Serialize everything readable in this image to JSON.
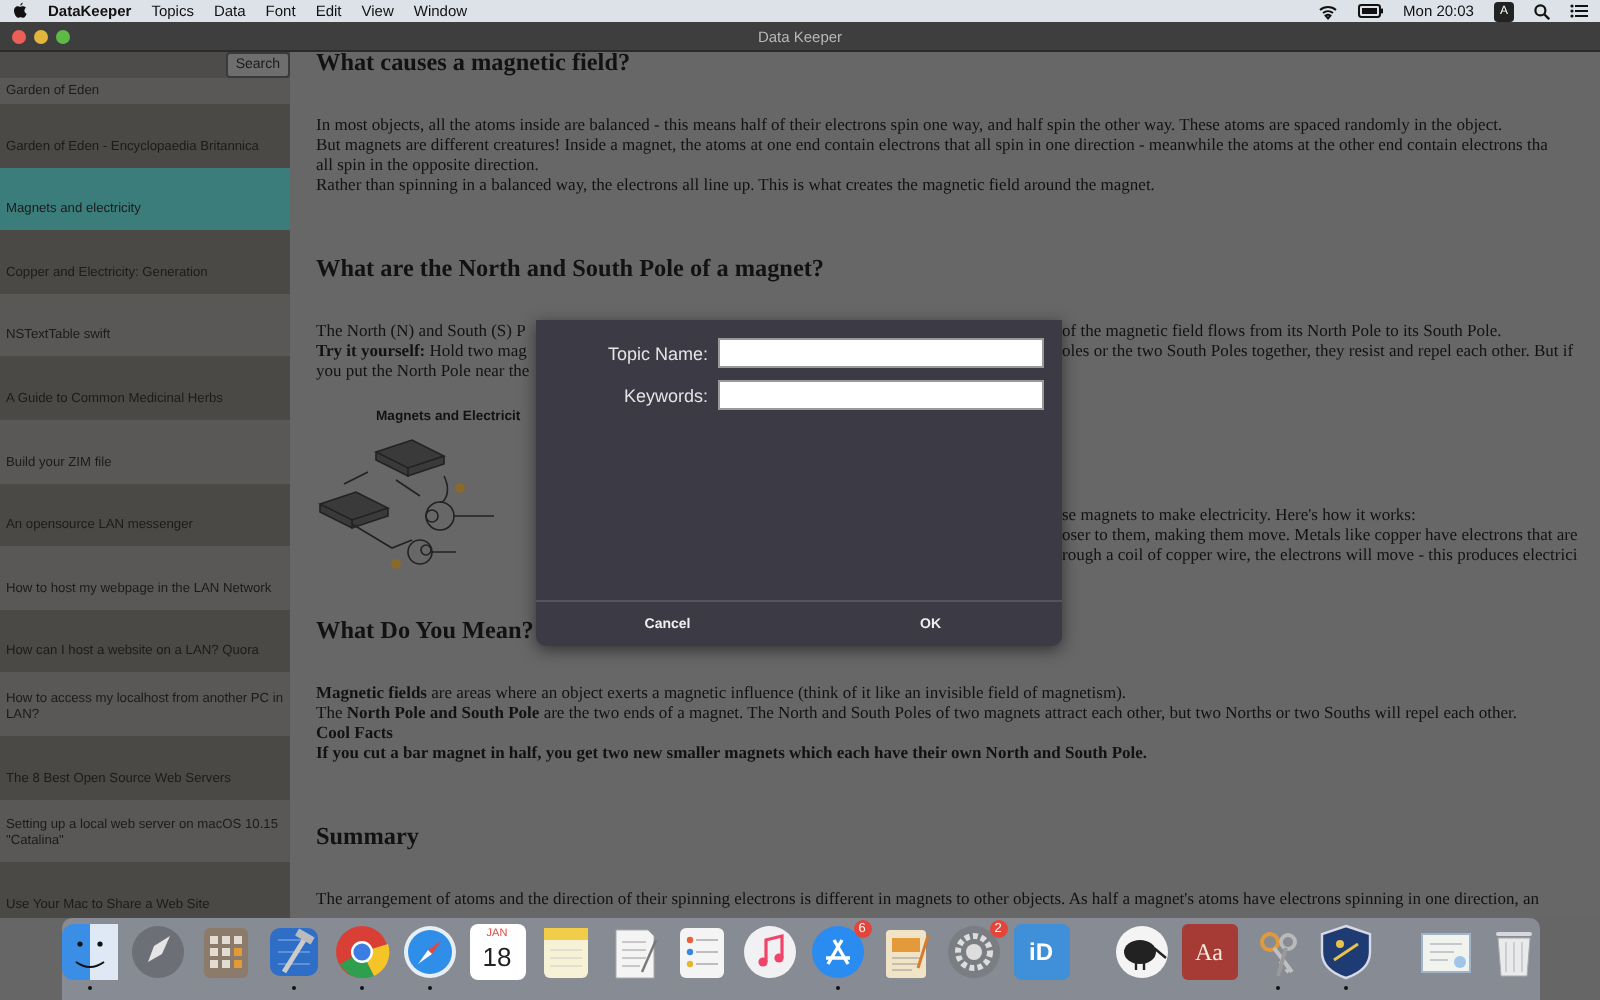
{
  "menubar": {
    "app_name": "DataKeeper",
    "menus": [
      "Topics",
      "Data",
      "Font",
      "Edit",
      "View",
      "Window"
    ],
    "clock": "Mon 20:03",
    "input_source": "A"
  },
  "window": {
    "title": "Data Keeper"
  },
  "sidebar": {
    "search_button": "Search",
    "items": [
      {
        "label": "Garden of Eden",
        "selected": false
      },
      {
        "label": "Garden of Eden - Encyclopaedia Britannica",
        "selected": false
      },
      {
        "label": "Magnets and electricity",
        "selected": true
      },
      {
        "label": "Copper and Electricity: Generation",
        "selected": false
      },
      {
        "label": "NSTextTable swift",
        "selected": false
      },
      {
        "label": "A Guide to Common Medicinal Herbs",
        "selected": false
      },
      {
        "label": "Build your ZIM file",
        "selected": false
      },
      {
        "label": "An opensource LAN messenger",
        "selected": false
      },
      {
        "label": "How to host my webpage in the LAN Network",
        "selected": false
      },
      {
        "label": "How can I host a website on a LAN? Quora",
        "selected": false
      },
      {
        "label": "How to access my localhost from another PC in LAN?",
        "selected": false
      },
      {
        "label": "The 8 Best Open Source Web Servers",
        "selected": false
      },
      {
        "label": "Setting up a local web server on macOS 10.15 \"Catalina\"",
        "selected": false
      },
      {
        "label": "Use Your Mac to Share a Web Site",
        "selected": false
      }
    ]
  },
  "article": {
    "blocks": [
      {
        "kind": "heading",
        "text": "What causes a magnetic field?"
      },
      {
        "kind": "paragraph",
        "lines": [
          {
            "text": "In most objects, all the atoms inside are balanced - this means half of their electrons spin one way, and half spin the other way. These atoms are spaced randomly in the object."
          },
          {
            "text": "But magnets are different creatures! Inside a magnet, the atoms at one end contain electrons that all spin in one direction - meanwhile the atoms at the other end contain electrons tha"
          },
          {
            "text": "all spin in the opposite direction."
          },
          {
            "text": "Rather than spinning in a balanced way, the electrons all line up. This is what creates the magnetic field around the magnet."
          }
        ]
      },
      {
        "kind": "heading",
        "text": "What are the North and South Pole of a magnet?"
      },
      {
        "kind": "paragraph",
        "lines": [
          {
            "left": "The North (N) and South (S) P",
            "right": "of the magnetic field flows from its North Pole to its South Pole."
          },
          {
            "left": "**Try it yourself:** Hold two mag",
            "right": "oles or the two South Poles together, they resist and repel each other. But if"
          },
          {
            "left": "you put the North Pole near the"
          }
        ]
      },
      {
        "kind": "figure",
        "title": "Magnets and Electricit",
        "lines": [
          {
            "right": "se magnets to make electricity. Here's how it works:"
          },
          {
            "right": "oser to them, making them move. Metals like copper have electrons that are"
          },
          {
            "right": "rough a coil of copper wire, the electrons will move - this produces electrici"
          }
        ]
      },
      {
        "kind": "heading",
        "text": "What Do You Mean?"
      },
      {
        "kind": "paragraph",
        "lines": [
          {
            "text": "**Magnetic fields** are areas where an object exerts a magnetic influence (think of it like an invisible field of magnetism)."
          },
          {
            "text": "The **North Pole and South Pole** are the two ends of a magnet. The North and South Poles of two magnets attract each other, but two Norths or two Souths will repel each other."
          },
          {
            "text": "Cool Facts",
            "bold": true
          },
          {
            "text": "If you cut a bar magnet in half, you get two new smaller magnets which each have their own North and South Pole.",
            "bold": true
          }
        ]
      },
      {
        "kind": "heading",
        "text": "Summary"
      },
      {
        "kind": "paragraph",
        "lines": [
          {
            "text": "The arrangement of atoms and the direction of their spinning electrons is different in magnets to other objects. As half a magnet's atoms have electrons spinning in one direction, an"
          }
        ]
      }
    ]
  },
  "dialog": {
    "fields": [
      {
        "label": "Topic Name:"
      },
      {
        "label": "Keywords:"
      }
    ],
    "buttons": [
      "Cancel",
      "OK"
    ]
  },
  "dock": {
    "items": [
      {
        "kind": "finder",
        "running": true
      },
      {
        "kind": "launchpad",
        "running": false
      },
      {
        "kind": "calculator",
        "running": false
      },
      {
        "kind": "xcode",
        "running": true
      },
      {
        "kind": "chrome",
        "running": true
      },
      {
        "kind": "safari",
        "running": true
      },
      {
        "kind": "calendar",
        "running": false,
        "month": "JAN",
        "day": "18"
      },
      {
        "kind": "notes",
        "running": false
      },
      {
        "kind": "textedit",
        "running": false
      },
      {
        "kind": "reminders",
        "running": false
      },
      {
        "kind": "music",
        "running": false
      },
      {
        "kind": "app_store",
        "running": true,
        "badge": "6"
      },
      {
        "kind": "pages",
        "running": false
      },
      {
        "kind": "system_preferences",
        "running": false,
        "badge": "2"
      },
      {
        "kind": "id_app",
        "running": false,
        "label": "iD"
      },
      {
        "kind": "separator"
      },
      {
        "kind": "kiwi",
        "running": false
      },
      {
        "kind": "dictionary",
        "running": false,
        "label": "Aa"
      },
      {
        "kind": "keychain",
        "running": true
      },
      {
        "kind": "shield",
        "running": true
      },
      {
        "kind": "separator"
      },
      {
        "kind": "certificate",
        "running": false
      },
      {
        "kind": "trash",
        "running": false
      }
    ]
  }
}
